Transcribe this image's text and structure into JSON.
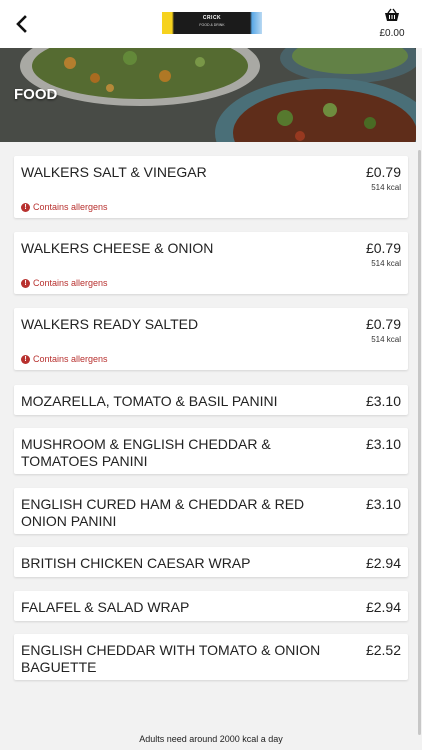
{
  "header": {
    "back_icon": "chevron-left-icon",
    "logo_line1": "CRICK",
    "logo_line2": "FOOD & DRINK",
    "basket_icon": "basket-icon",
    "basket_total": "£0.00"
  },
  "hero": {
    "title": "FOOD"
  },
  "items": [
    {
      "name": "WALKERS SALT & VINEGAR",
      "price": "£0.79",
      "kcal": "514 kcal",
      "allergen": "Contains allergens"
    },
    {
      "name": "WALKERS CHEESE & ONION",
      "price": "£0.79",
      "kcal": "514 kcal",
      "allergen": "Contains allergens"
    },
    {
      "name": "WALKERS READY SALTED",
      "price": "£0.79",
      "kcal": "514 kcal",
      "allergen": "Contains allergens"
    },
    {
      "name": "MOZARELLA, TOMATO & BASIL PANINI",
      "price": "£3.10"
    },
    {
      "name": "MUSHROOM & ENGLISH CHEDDAR & TOMATOES PANINI",
      "price": "£3.10"
    },
    {
      "name": "ENGLISH CURED HAM & CHEDDAR & RED ONION PANINI",
      "price": "£3.10"
    },
    {
      "name": "BRITISH CHICKEN CAESAR WRAP",
      "price": "£2.94"
    },
    {
      "name": "FALAFEL & SALAD WRAP",
      "price": "£2.94"
    },
    {
      "name": "ENGLISH CHEDDAR WITH TOMATO & ONION BAGUETTE",
      "price": "£2.52"
    }
  ],
  "footer": {
    "note": "Adults need around 2000 kcal a day"
  },
  "colors": {
    "allergen": "#b8312f",
    "background": "#f2f2f2"
  }
}
